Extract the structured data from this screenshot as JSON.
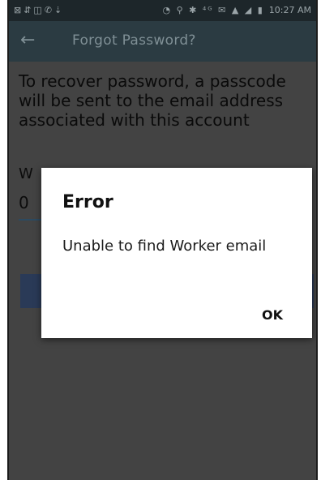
{
  "status_bar": {
    "left_icons": "⊠⇵◫✆⇣",
    "right_icons": "◔ ⚲ ✱ ⁴ᴳ ✉ ▲ ◢ ▮",
    "time": "10:27 AM"
  },
  "toolbar": {
    "back_icon": "←",
    "title": "Forgot Password?"
  },
  "content": {
    "message": "To recover password, a passcode will be sent to the email address associated with this account",
    "field_label_char": "W",
    "field_value_char": "0"
  },
  "dialog": {
    "title": "Error",
    "body": "Unable to find Worker email",
    "ok_label": "OK"
  }
}
